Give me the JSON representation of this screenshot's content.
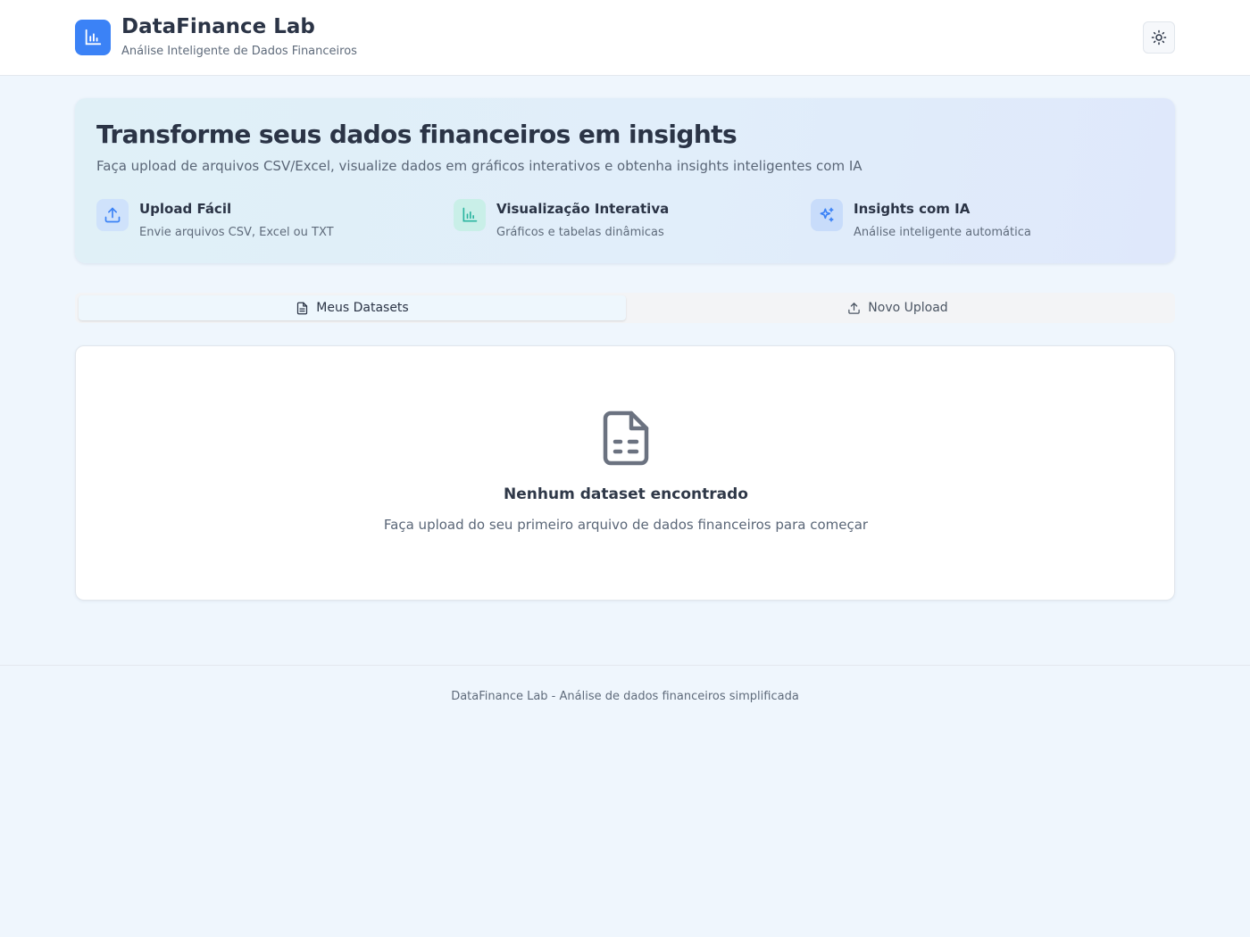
{
  "header": {
    "title": "DataFinance Lab",
    "subtitle": "Análise Inteligente de Dados Financeiros",
    "logo_icon": "bar-chart-icon",
    "theme_icon": "sun-icon"
  },
  "hero": {
    "title": "Transforme seus dados financeiros em insights",
    "description": "Faça upload de arquivos CSV/Excel, visualize dados em gráficos interativos e obtenha insights inteligentes com IA",
    "features": [
      {
        "title": "Upload Fácil",
        "description": "Envie arquivos CSV, Excel ou TXT",
        "icon": "upload-icon"
      },
      {
        "title": "Visualização Interativa",
        "description": "Gráficos e tabelas dinâmicas",
        "icon": "bar-chart-icon"
      },
      {
        "title": "Insights com IA",
        "description": "Análise inteligente automática",
        "icon": "sparkles-icon"
      }
    ]
  },
  "tabs": [
    {
      "label": "Meus Datasets",
      "icon": "file-icon",
      "active": true
    },
    {
      "label": "Novo Upload",
      "icon": "upload-icon",
      "active": false
    }
  ],
  "empty_state": {
    "icon": "file-spreadsheet-icon",
    "title": "Nenhum dataset encontrado",
    "description": "Faça upload do seu primeiro arquivo de dados financeiros para começar"
  },
  "footer": {
    "text": "DataFinance Lab - Análise de dados financeiros simplificada"
  },
  "colors": {
    "accent": "#3b82f6",
    "background": "#eff6fd",
    "feature_upload_bg": "#cfe2fb",
    "feature_chart_bg": "#c9efe8",
    "feature_ai_bg": "#c8dcfa"
  }
}
